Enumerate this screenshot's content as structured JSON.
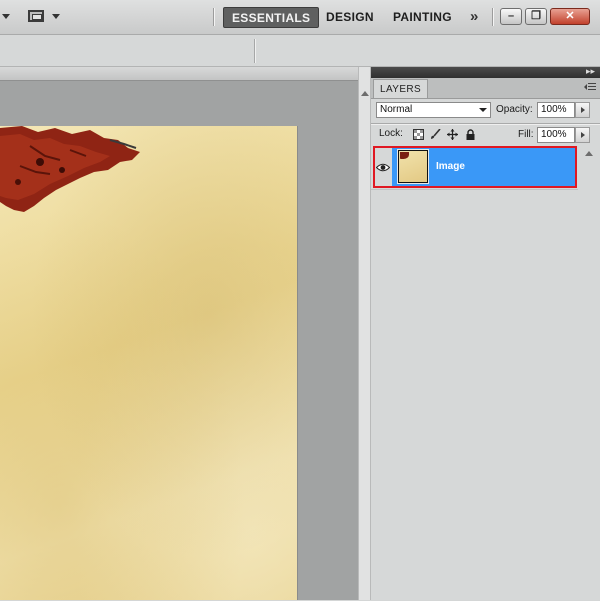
{
  "topbar": {
    "workspaces": [
      "ESSENTIALS",
      "DESIGN",
      "PAINTING"
    ],
    "active_workspace": "ESSENTIALS",
    "more_workspaces_glyph": "»",
    "window_buttons": [
      "minimize-icon",
      "restore-icon",
      "close-icon"
    ]
  },
  "layers_panel": {
    "tab_label": "LAYERS",
    "blend_mode": "Normal",
    "opacity_label": "Opacity:",
    "opacity_value": "100%",
    "lock_label": "Lock:",
    "lock_icons": [
      "lock-transparent-icon",
      "lock-image-icon",
      "lock-position-icon",
      "lock-all-icon"
    ],
    "fill_label": "Fill:",
    "fill_value": "100%",
    "layers": [
      {
        "name": "Image",
        "visible": true,
        "selected": true
      }
    ]
  },
  "colors": {
    "selection": "#3a98f7",
    "highlight_border": "#e01822",
    "panel_bg": "#d6d8d8",
    "canvas_paper": "#f0e0a8",
    "leaf": "#8f2414"
  }
}
